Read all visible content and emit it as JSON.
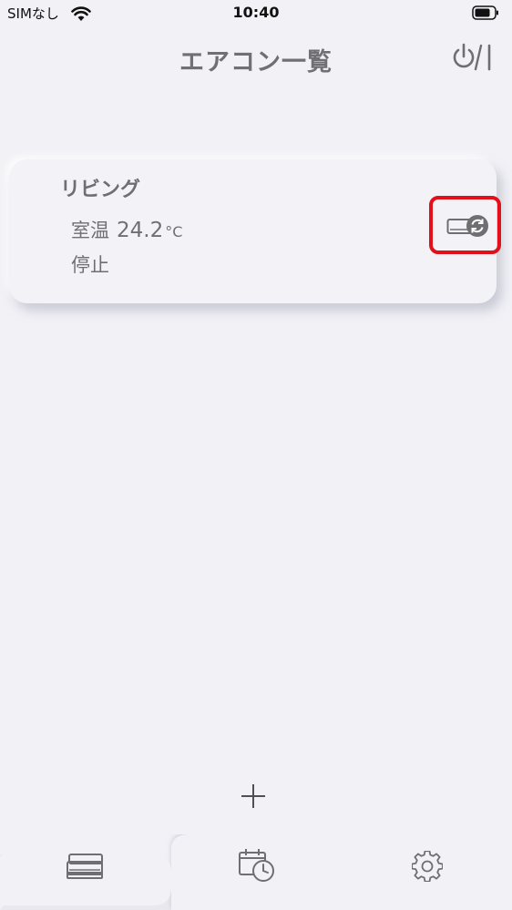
{
  "status_bar": {
    "carrier": "SIMなし",
    "time": "10:40",
    "icons": [
      "wifi-icon",
      "battery-icon"
    ]
  },
  "header": {
    "title": "エアコン一覧",
    "power_button_icon": "power-toggle-icon"
  },
  "units": [
    {
      "name": "リビング",
      "temp_label": "室温",
      "temp_value": "24.2",
      "temp_unit": "°C",
      "status": "停止",
      "icon": "air-conditioner-sync-icon",
      "highlighted": true
    }
  ],
  "add_button_icon": "plus-icon",
  "tabs": [
    {
      "icon": "air-conditioner-list-icon",
      "selected": true
    },
    {
      "icon": "calendar-clock-icon",
      "selected": false
    },
    {
      "icon": "gear-icon",
      "selected": false
    }
  ],
  "colors": {
    "background": "#f1f1f6",
    "text": "#6f6f73",
    "highlight": "#e2101b"
  }
}
